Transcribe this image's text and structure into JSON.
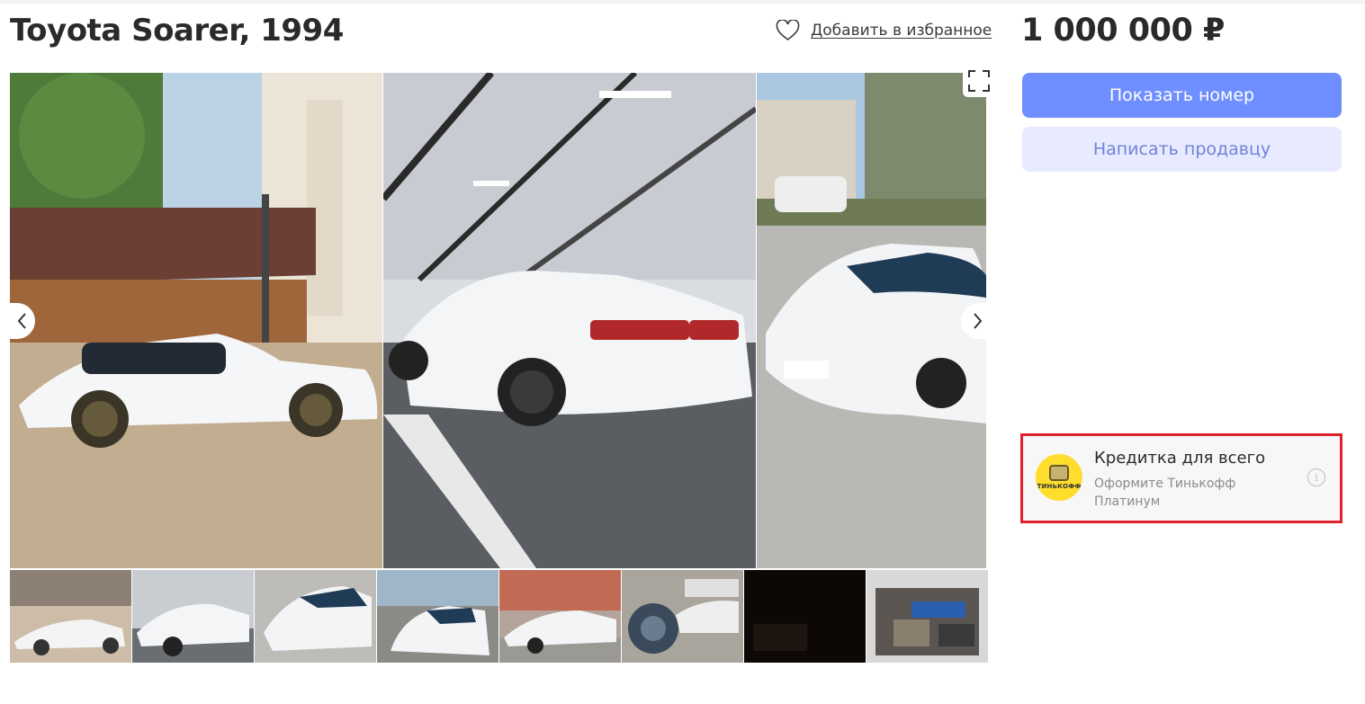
{
  "listing": {
    "title": "Toyota Soarer, 1994",
    "favorite_label": "Добавить в избранное",
    "price": "1 000 000 ₽"
  },
  "actions": {
    "show_number_label": "Показать номер",
    "write_seller_label": "Написать продавцу"
  },
  "gallery": {
    "main_photos": [
      "car-side-view-photo",
      "car-rear-parking-photo",
      "car-front-street-photo"
    ],
    "thumbnail_count": 8,
    "icons": {
      "prev": "chevron-left-icon",
      "next": "chevron-right-icon",
      "fullscreen": "fullscreen-icon",
      "favorite": "heart-outline-icon"
    }
  },
  "ad": {
    "title": "Кредитка для всего",
    "subtitle": "Оформите Тинькофф Платинум",
    "logo_text": "ТИНЬКОФФ",
    "info_glyph": "i"
  },
  "colors": {
    "primary_button": "#6f8eff",
    "secondary_button": "#e8ebff",
    "ad_highlight_border": "#e0202a",
    "ad_logo": "#ffdd2d"
  }
}
